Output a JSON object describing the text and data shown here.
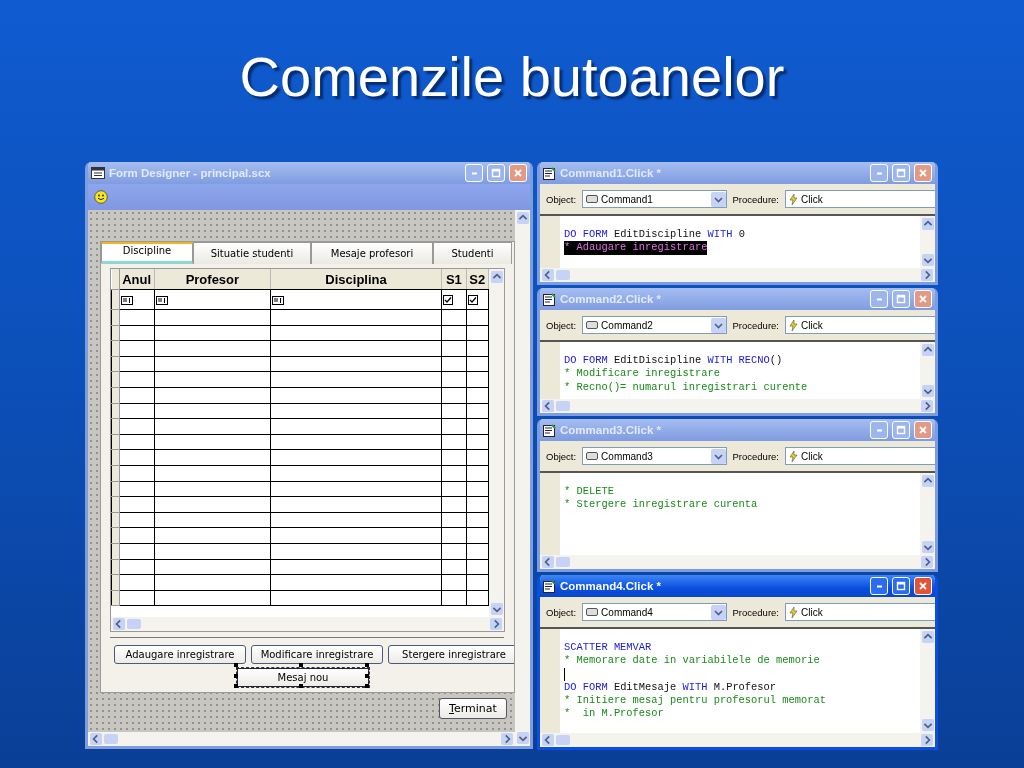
{
  "slide_title": "Comenzile butoanelor",
  "form_designer": {
    "title": "Form Designer - principal.scx",
    "active": false,
    "tabs": [
      {
        "label": "Discipline",
        "selected": true
      },
      {
        "label": "Situatie studenti",
        "selected": false
      },
      {
        "label": "Mesaje profesori",
        "selected": false
      },
      {
        "label": "Studenti",
        "selected": false
      }
    ],
    "grid": {
      "columns": [
        "Anul",
        "Profesor",
        "Disciplina",
        "S1",
        "S2"
      ],
      "first_row": [
        {
          "kind": "textbox"
        },
        {
          "kind": "textbox"
        },
        {
          "kind": "textbox"
        },
        {
          "kind": "checkbox",
          "checked": true
        },
        {
          "kind": "checkbox",
          "checked": true
        }
      ]
    },
    "buttons": [
      {
        "label": "Adaugare inregistrare",
        "selected": false
      },
      {
        "label": "Modificare inregistrare",
        "selected": false
      },
      {
        "label": "Stergere inregistrare",
        "selected": false
      },
      {
        "label": "Mesaj nou",
        "selected": true
      }
    ],
    "close_button": "Terminat"
  },
  "code_windows": [
    {
      "title": "Command1.Click *",
      "active": false,
      "object_label": "Object:",
      "object": "Command1",
      "procedure_label": "Procedure:",
      "procedure": "Click",
      "lines": [
        {
          "highlighted": false,
          "tokens": [
            {
              "kind": "keyword",
              "text": "DO FORM"
            },
            {
              "kind": "plain",
              "text": " EditDiscipline "
            },
            {
              "kind": "keyword",
              "text": "WITH"
            },
            {
              "kind": "plain",
              "text": " 0"
            }
          ]
        },
        {
          "highlighted": true,
          "tokens": [
            {
              "kind": "comment",
              "text": "* Adaugare inregistrare"
            }
          ]
        }
      ]
    },
    {
      "title": "Command2.Click *",
      "active": false,
      "object_label": "Object:",
      "object": "Command2",
      "procedure_label": "Procedure:",
      "procedure": "Click",
      "lines": [
        {
          "highlighted": false,
          "tokens": [
            {
              "kind": "keyword",
              "text": "DO FORM"
            },
            {
              "kind": "plain",
              "text": " EditDiscipline "
            },
            {
              "kind": "keyword",
              "text": "WITH RECNO"
            },
            {
              "kind": "plain",
              "text": "()"
            }
          ]
        },
        {
          "highlighted": false,
          "tokens": [
            {
              "kind": "comment",
              "text": "* Modificare inregistrare"
            }
          ]
        },
        {
          "highlighted": false,
          "tokens": [
            {
              "kind": "comment",
              "text": "* Recno()= numarul inregistrari curente"
            }
          ]
        }
      ]
    },
    {
      "title": "Command3.Click *",
      "active": false,
      "object_label": "Object:",
      "object": "Command3",
      "procedure_label": "Procedure:",
      "procedure": "Click",
      "lines": [
        {
          "highlighted": false,
          "tokens": [
            {
              "kind": "comment",
              "text": "* DELETE"
            }
          ]
        },
        {
          "highlighted": false,
          "tokens": [
            {
              "kind": "comment",
              "text": "* Stergere inregistrare curenta"
            }
          ]
        }
      ]
    },
    {
      "title": "Command4.Click *",
      "active": true,
      "object_label": "Object:",
      "object": "Command4",
      "procedure_label": "Procedure:",
      "procedure": "Click",
      "lines": [
        {
          "highlighted": false,
          "tokens": [
            {
              "kind": "keyword",
              "text": "SCATTER MEMVAR"
            }
          ]
        },
        {
          "highlighted": false,
          "tokens": [
            {
              "kind": "comment",
              "text": "* Memorare date in variabilele de memorie"
            }
          ]
        },
        {
          "highlighted": false,
          "cursor": true
        },
        {
          "highlighted": false,
          "tokens": [
            {
              "kind": "keyword",
              "text": "DO FORM"
            },
            {
              "kind": "plain",
              "text": " EditMesaje "
            },
            {
              "kind": "keyword",
              "text": "WITH"
            },
            {
              "kind": "plain",
              "text": " M.Profesor"
            }
          ]
        },
        {
          "highlighted": false,
          "tokens": [
            {
              "kind": "comment",
              "text": "* Initiere mesaj pentru profesorul memorat"
            }
          ]
        },
        {
          "highlighted": false,
          "tokens": [
            {
              "kind": "comment",
              "text": "*  in M.Profesor"
            }
          ]
        }
      ]
    }
  ]
}
